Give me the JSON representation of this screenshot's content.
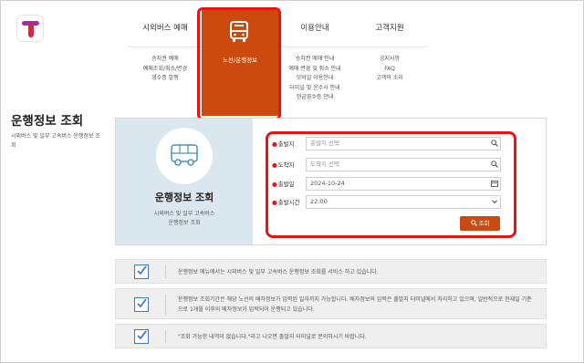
{
  "nav": {
    "columns": [
      {
        "title": "시외버스 예매",
        "items": [
          "승차권 예매",
          "예매조회/취소/변경",
          "영수증 발행"
        ]
      },
      {
        "title": "",
        "items": []
      },
      {
        "title": "이용안내",
        "items": [
          "승차권 예매 안내",
          "예매 변경 및 취소 안내",
          "모바일 이용안내",
          "터미널 및 운수사 안내",
          "현금영수증 안내"
        ]
      },
      {
        "title": "고객지원",
        "items": [
          "공지사항",
          "FAQ",
          "고객의 소리"
        ]
      }
    ],
    "active": {
      "label": "노선/운행정보",
      "icon": "bus-icon"
    }
  },
  "page": {
    "title": "운행정보 조회",
    "description": "시외버스 및 일부 고속버스 운행정보 조회"
  },
  "card": {
    "title": "운행정보 조회",
    "description_line1": "시외버스 및 일부 고속버스",
    "description_line2": "운행정보 조회",
    "icon": "bus-icon"
  },
  "form": {
    "departure": {
      "label": "출발지",
      "placeholder": "출발지 선택"
    },
    "arrival": {
      "label": "도착지",
      "placeholder": "도착지 선택"
    },
    "date": {
      "label": "출발일",
      "value": "2024-10-24"
    },
    "time": {
      "label": "출발시간",
      "value": "22:00"
    },
    "search_label": "조회"
  },
  "notices": [
    "운행정보 메뉴에서는 시외버스 및 일부 고속버스 운행정보 조회를 서비스 하고 있습니다.",
    "운행정보 조회기간은 해당 노선의 배차정보가 입력된 일자까지 가능합니다. 배차정보의 입력은 출발지 터미널에서 처리하고 있으며, 일반적으로 현재일 기준으로 1개월 이후의 배차정보가 입력되어 운행되고 있습니다.",
    "\"조회 가능한 내역이 없습니다.\"라고 나오면 출발지 터미널로 문의하시기 바랍니다."
  ],
  "colors": {
    "accent": "#cc4a0e",
    "highlight": "#ee1111",
    "panel": "#dbe7ef",
    "check": "#3b7dbd"
  }
}
